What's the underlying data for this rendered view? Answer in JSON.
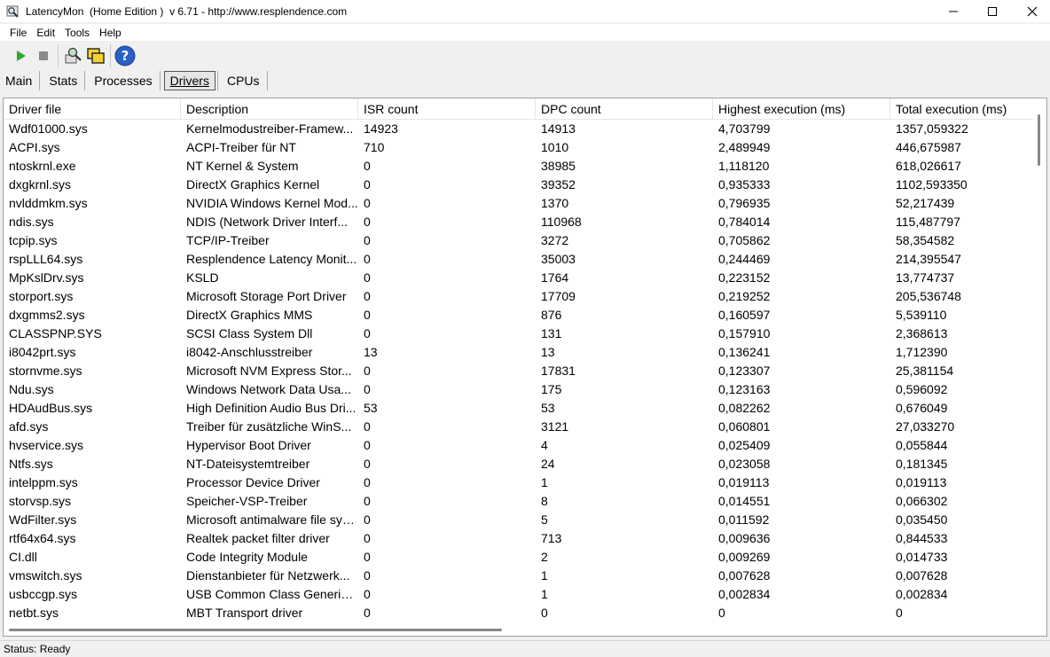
{
  "window": {
    "title": "LatencyMon  (Home Edition )  v 6.71 - http://www.resplendence.com",
    "app_icon": "magnifier-icon",
    "controls": [
      "minimize-icon",
      "maximize-icon",
      "close-icon"
    ]
  },
  "menu": [
    "File",
    "Edit",
    "Tools",
    "Help"
  ],
  "toolbar": {
    "buttons": [
      "play-icon",
      "stop-icon",
      "monitor-icon",
      "windows-icon",
      "help-icon"
    ],
    "colors": {
      "play": "#2eaa2e",
      "stop": "#8a8a8a",
      "help": "#2a5fc4"
    }
  },
  "tabs": [
    "Main",
    "Stats",
    "Processes",
    "Drivers",
    "CPUs"
  ],
  "active_tab": "Drivers",
  "table": {
    "columns": [
      "Driver file",
      "Description",
      "ISR count",
      "DPC count",
      "Highest execution (ms)",
      "Total execution (ms)"
    ],
    "rows": [
      [
        "Wdf01000.sys",
        "Kernelmodustreiber-Framew...",
        "14923",
        "14913",
        "4,703799",
        "1357,059322"
      ],
      [
        "ACPI.sys",
        "ACPI-Treiber für NT",
        "710",
        "1010",
        "2,489949",
        "446,675987"
      ],
      [
        "ntoskrnl.exe",
        "NT Kernel & System",
        "0",
        "38985",
        "1,118120",
        "618,026617"
      ],
      [
        "dxgkrnl.sys",
        "DirectX Graphics Kernel",
        "0",
        "39352",
        "0,935333",
        "1102,593350"
      ],
      [
        "nvlddmkm.sys",
        "NVIDIA Windows Kernel Mod...",
        "0",
        "1370",
        "0,796935",
        "52,217439"
      ],
      [
        "ndis.sys",
        "NDIS (Network Driver Interf...",
        "0",
        "110968",
        "0,784014",
        "115,487797"
      ],
      [
        "tcpip.sys",
        "TCP/IP-Treiber",
        "0",
        "3272",
        "0,705862",
        "58,354582"
      ],
      [
        "rspLLL64.sys",
        "Resplendence Latency Monit...",
        "0",
        "35003",
        "0,244469",
        "214,395547"
      ],
      [
        "MpKslDrv.sys",
        "KSLD",
        "0",
        "1764",
        "0,223152",
        "13,774737"
      ],
      [
        "storport.sys",
        "Microsoft Storage Port Driver",
        "0",
        "17709",
        "0,219252",
        "205,536748"
      ],
      [
        "dxgmms2.sys",
        "DirectX Graphics MMS",
        "0",
        "876",
        "0,160597",
        "5,539110"
      ],
      [
        "CLASSPNP.SYS",
        "SCSI Class System Dll",
        "0",
        "131",
        "0,157910",
        "2,368613"
      ],
      [
        "i8042prt.sys",
        "i8042-Anschlusstreiber",
        "13",
        "13",
        "0,136241",
        "1,712390"
      ],
      [
        "stornvme.sys",
        "Microsoft NVM Express Stor...",
        "0",
        "17831",
        "0,123307",
        "25,381154"
      ],
      [
        "Ndu.sys",
        "Windows Network Data Usa...",
        "0",
        "175",
        "0,123163",
        "0,596092"
      ],
      [
        "HDAudBus.sys",
        "High Definition Audio Bus Dri...",
        "53",
        "53",
        "0,082262",
        "0,676049"
      ],
      [
        "afd.sys",
        "Treiber für zusätzliche WinS...",
        "0",
        "3121",
        "0,060801",
        "27,033270"
      ],
      [
        "hvservice.sys",
        "Hypervisor Boot Driver",
        "0",
        "4",
        "0,025409",
        "0,055844"
      ],
      [
        "Ntfs.sys",
        "NT-Dateisystemtreiber",
        "0",
        "24",
        "0,023058",
        "0,181345"
      ],
      [
        "intelppm.sys",
        "Processor Device Driver",
        "0",
        "1",
        "0,019113",
        "0,019113"
      ],
      [
        "storvsp.sys",
        "Speicher-VSP-Treiber",
        "0",
        "8",
        "0,014551",
        "0,066302"
      ],
      [
        "WdFilter.sys",
        "Microsoft antimalware file sys...",
        "0",
        "5",
        "0,011592",
        "0,035450"
      ],
      [
        "rtf64x64.sys",
        "Realtek packet filter driver",
        "0",
        "713",
        "0,009636",
        "0,844533"
      ],
      [
        "CI.dll",
        "Code Integrity Module",
        "0",
        "2",
        "0,009269",
        "0,014733"
      ],
      [
        "vmswitch.sys",
        "Dienstanbieter für Netzwerk...",
        "0",
        "1",
        "0,007628",
        "0,007628"
      ],
      [
        "usbccgp.sys",
        "USB Common Class Generic ...",
        "0",
        "1",
        "0,002834",
        "0,002834"
      ],
      [
        "netbt.sys",
        "MBT Transport driver",
        "0",
        "0",
        "0",
        "0"
      ]
    ]
  },
  "status": "Status: Ready"
}
